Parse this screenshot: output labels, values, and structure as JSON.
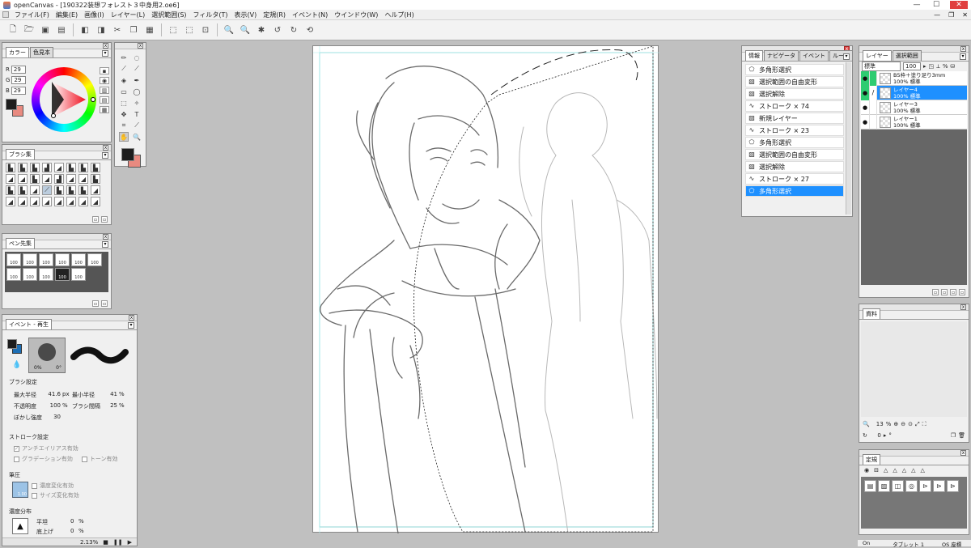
{
  "window": {
    "app": "openCanvas",
    "title": "openCanvas - [190322装想フォレスト３中身用2.oe6]",
    "controls": [
      "—",
      "☐",
      "✕"
    ]
  },
  "menu": [
    "ファイル(F)",
    "編集(E)",
    "画像(I)",
    "レイヤー(L)",
    "選択範囲(S)",
    "フィルタ(T)",
    "表示(V)",
    "定規(R)",
    "イベント(N)",
    "ウインドウ(W)",
    "ヘルプ(H)"
  ],
  "mdi_controls": [
    "—",
    "❐",
    "✕"
  ],
  "color_panel": {
    "tabs": [
      "カラー",
      "色見本"
    ],
    "r": "29",
    "g": "29",
    "b": "29",
    "labels": [
      "R",
      "G",
      "B"
    ]
  },
  "brush_panel": {
    "tab": "ブラシ集"
  },
  "pen_panel": {
    "tab": "ペン先集",
    "sizes": [
      "100",
      "100",
      "100",
      "100",
      "100",
      "100",
      "100",
      "100",
      "100",
      "100",
      "100"
    ]
  },
  "event_panel": {
    "tab": "イベント - 再生",
    "pct": "0%",
    "deg": "0°",
    "brush_settings_title": "ブラシ設定",
    "max_radius_label": "最大半径",
    "max_radius_value": "41.6",
    "max_radius_unit": "px",
    "min_radius_label": "最小半径",
    "min_radius_value": "41",
    "min_radius_unit": "%",
    "opacity_label": "不透明度",
    "opacity_value": "100",
    "opacity_unit": "%",
    "spacing_label": "ブラシ間隔",
    "spacing_value": "25",
    "spacing_unit": "%",
    "blur_label": "ぼかし強度",
    "blur_value": "30",
    "stroke_title": "ストローク設定",
    "antialias": "アンチエイリアス有効",
    "gradation": "グラデーション有効",
    "tone": "トーン有効",
    "pressure_title": "筆圧",
    "density_change": "濃度変化有効",
    "size_change": "サイズ変化有効",
    "pressure_value": "1.00",
    "density_title": "濃度分布",
    "flat_label": "平坦",
    "flat_value": "0",
    "flat_unit": "%",
    "base_label": "底上げ",
    "base_value": "0",
    "base_unit": "%",
    "zoom": "2.13%"
  },
  "info_panel": {
    "tabs": [
      "情報",
      "ナビゲータ",
      "イベント",
      "ルーペ"
    ],
    "history": [
      {
        "icon": "lasso-icon",
        "label": "多角形選択"
      },
      {
        "icon": "select-icon",
        "label": "選択範囲の自由変形"
      },
      {
        "icon": "select-icon",
        "label": "選択解除"
      },
      {
        "icon": "stroke-icon",
        "label": "ストローク × 74"
      },
      {
        "icon": "select-icon",
        "label": "新規レイヤー"
      },
      {
        "icon": "stroke-icon",
        "label": "ストローク × 23"
      },
      {
        "icon": "lasso-icon",
        "label": "多角形選択"
      },
      {
        "icon": "select-icon",
        "label": "選択範囲の自由変形"
      },
      {
        "icon": "select-icon",
        "label": "選択解除"
      },
      {
        "icon": "stroke-icon",
        "label": "ストローク × 27"
      },
      {
        "icon": "lasso-icon",
        "label": "多角形選択",
        "selected": true
      }
    ]
  },
  "layer_panel": {
    "tabs": [
      "レイヤー",
      "選択範囲"
    ],
    "blend": "標準",
    "opacity": "100",
    "layers": [
      {
        "name": "B5枠＋塗り足り3mm",
        "sub": "100% 標準",
        "green": true
      },
      {
        "name": "レイヤー4",
        "sub": "100% 標準",
        "selected": true,
        "green": true
      },
      {
        "name": "レイヤー3",
        "sub": "100% 標準"
      },
      {
        "name": "レイヤー1",
        "sub": "100% 標準"
      }
    ]
  },
  "material_panel": {
    "tab": "資料",
    "zoom": "13",
    "zoom_unit": "%",
    "angle": "0",
    "angle_unit": "°"
  },
  "ruler_panel": {
    "tab": "定規"
  },
  "statusbar": {
    "on": "On",
    "tablet": "タブレット 1",
    "os": "OS 座標"
  },
  "colors": {
    "accent": "#1e90ff",
    "green": "#2ecc71",
    "fg": "#1d1d1d",
    "bg": "#e88a80"
  }
}
